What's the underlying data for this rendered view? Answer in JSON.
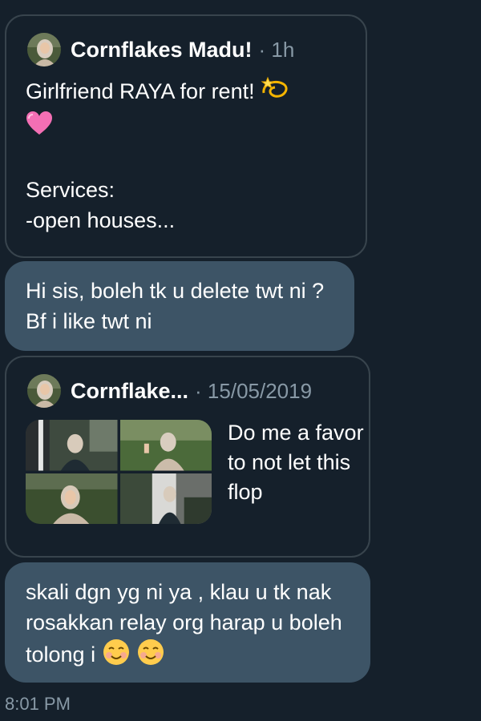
{
  "shared_tweet": {
    "author": "Cornflakes Madu!",
    "separator_time": "· 1h",
    "text_line1": "Girlfriend RAYA for rent!",
    "text_rest": "\n\nServices:\n-open houses...",
    "emojis": [
      "dizzy-emoji",
      "pink-heart-emoji"
    ]
  },
  "message1": {
    "text": "Hi sis, boleh tk u delete twt ni ? Bf i like twt ni"
  },
  "quoted_tweet": {
    "author": "Cornflake...",
    "separator_time": "· 15/05/2019",
    "text": "Do me a favor to not let this flop",
    "photo_count": 4
  },
  "message2": {
    "text": "skali dgn yg ni ya , klau u tk nak rosakkan relay org harap u boleh tolong i",
    "emojis": [
      "smiling-face-emoji",
      "smiling-face-emoji"
    ]
  },
  "timestamp": "8:01 PM",
  "colors": {
    "background": "#15202b",
    "card_border": "#38444d",
    "bubble": "#3d5466",
    "secondary_text": "#8899a6"
  }
}
